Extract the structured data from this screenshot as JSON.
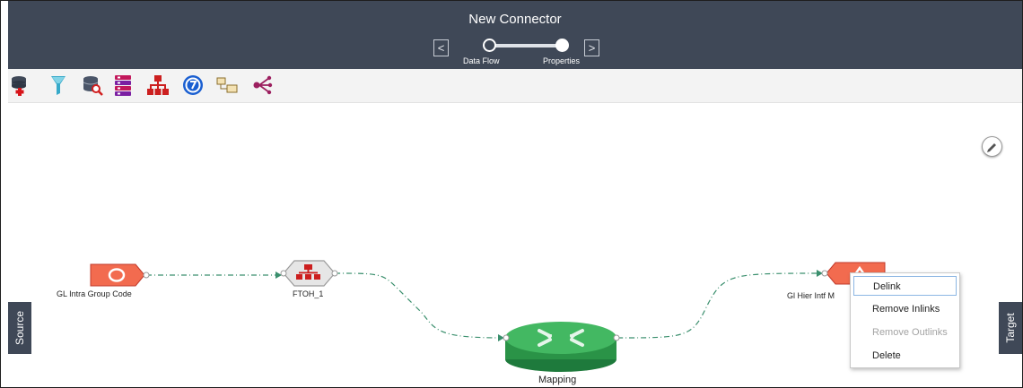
{
  "header": {
    "title": "New Connector",
    "prev_icon": "chevron-left-icon",
    "next_icon": "chevron-right-icon",
    "prev_glyph": "<",
    "next_glyph": ">",
    "steps": [
      {
        "label": "Data Flow",
        "state": "current"
      },
      {
        "label": "Properties",
        "state": "upcoming"
      }
    ]
  },
  "toolbar": {
    "icons": [
      "add-source-database-icon",
      "filter-icon",
      "database-search-icon",
      "table-list-icon",
      "hierarchy-icon",
      "expression-icon",
      "mapping-table-icon",
      "split-flow-icon"
    ]
  },
  "canvas": {
    "edit_icon": "pencil-icon",
    "nodes": [
      {
        "label": "GL Intra Group Code",
        "type": "source"
      },
      {
        "label": "FTOH_1",
        "type": "hierarchy"
      },
      {
        "label": "Mapping",
        "type": "mapping"
      },
      {
        "label": "Gl Hier Intf M",
        "type": "target"
      }
    ]
  },
  "side_tabs": {
    "source": "Source",
    "target": "Target"
  },
  "context_menu": {
    "items": [
      {
        "label": "Delink",
        "state": "highlighted"
      },
      {
        "label": "Remove Inlinks",
        "state": "enabled"
      },
      {
        "label": "Remove Outlinks",
        "state": "disabled"
      },
      {
        "label": "Delete",
        "state": "enabled"
      }
    ]
  },
  "colors": {
    "header_bg": "#3f4857",
    "toolbar_bg": "#f3f3f3",
    "source_node": "#f26b4f",
    "mapping_node": "#2ea44f",
    "link_line": "#3a8f6d",
    "hierarchy_icon": "#cc1f1f",
    "expression_icon": "#1a5fd1"
  }
}
